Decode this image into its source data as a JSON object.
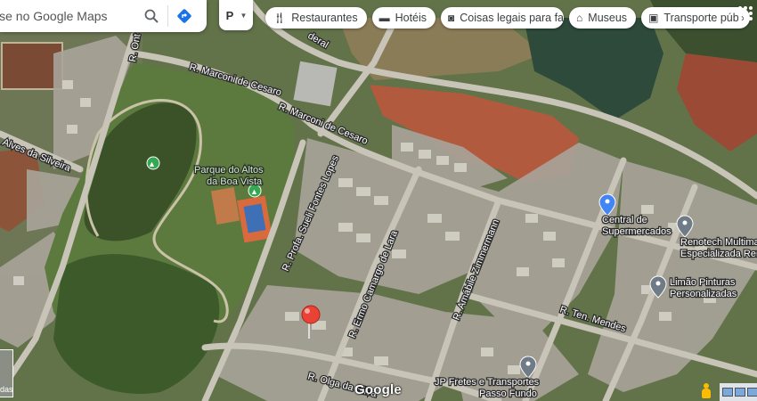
{
  "search": {
    "placeholder": "ise no Google Maps",
    "search_icon": "search-icon",
    "directions_icon": "directions-icon"
  },
  "layer_toggle": {
    "label": "P",
    "icon": "pharmacy-icon"
  },
  "chips": [
    {
      "label": "Restaurantes",
      "icon": "fork-knife-icon"
    },
    {
      "label": "Hotéis",
      "icon": "bed-icon"
    },
    {
      "label": "Coisas legais para fa",
      "icon": "camera-icon"
    },
    {
      "label": "Museus",
      "icon": "museum-icon"
    },
    {
      "label": "Transporte púb",
      "icon": "bus-icon"
    }
  ],
  "map": {
    "streets": [
      "R. Marconi de Cesaro",
      "R. Marconi de Cesaro",
      "R. Profa. Sueli Fontes Lopes",
      "R. Ermo Camargo de Lara",
      "R. Amábile Zimmermann",
      "R. Olga da Silva",
      "Alves da Silveira",
      "R. Ten. Mendes",
      "R. Ont",
      "deral"
    ],
    "pois": [
      {
        "label": "Parque do Altos da Boa Vista",
        "lines": [
          "Parque do Altos",
          "da Boa Vista"
        ],
        "color": "#34a853"
      },
      {
        "label": "Central de Supermercados",
        "lines": [
          "Central de",
          "Supermercados"
        ],
        "color": "#4285f4"
      },
      {
        "label": "Renotech Multimarcas Especializada Renault",
        "lines": [
          "Renotech Multima",
          "Especializada Ren"
        ],
        "color": "#6f7b86"
      },
      {
        "label": "Limão Pinturas Personalizadas",
        "lines": [
          "Limão Pinturas",
          "Personalizadas"
        ],
        "color": "#6f7b86"
      },
      {
        "label": "JP Fretes e Transportes Passo Fundo",
        "lines": [
          "JP Fretes e Transportes",
          "Passo Fundo"
        ],
        "color": "#6f7b86"
      }
    ],
    "marker": {
      "type": "selected-location-pin",
      "color": "#ea4335"
    }
  },
  "bottom": {
    "logo": "Google",
    "thumbnail_label": "das"
  },
  "colors": {
    "grass": "#5f7448",
    "dark_forest": "#3f4f2d",
    "red_soil": "#b5563b",
    "water": "#2f4a3c"
  }
}
